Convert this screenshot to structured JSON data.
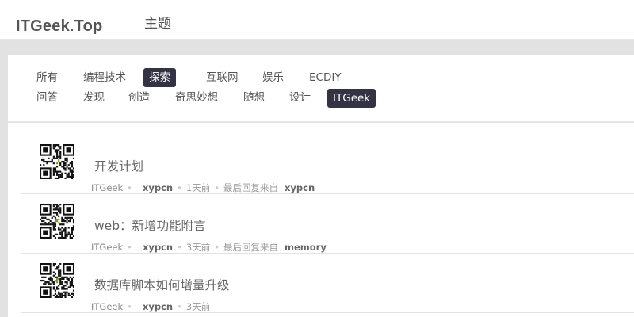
{
  "header": {
    "site_title": "ITGeek.Top",
    "nav_topics": "主题"
  },
  "tabs": {
    "row1": [
      "所有",
      "编程技术",
      "探索",
      "互联网",
      "娱乐",
      "ECDIY"
    ],
    "row2": [
      "问答",
      "发现",
      "创造",
      "奇思妙想",
      "随想",
      "设计",
      "ITGeek"
    ],
    "active": [
      "探索",
      "ITGeek"
    ]
  },
  "topics": [
    {
      "title": "开发计划",
      "node": "ITGeek",
      "author": "xypcn",
      "time": "1天前",
      "last_reply_label": "最后回复来自",
      "last_reply_user": "xypcn"
    },
    {
      "title": "web：新增功能附言",
      "node": "ITGeek",
      "author": "xypcn",
      "time": "3天前",
      "last_reply_label": "最后回复来自",
      "last_reply_user": "memory"
    },
    {
      "title": "数据库脚本如何增量升级",
      "node": "ITGeek",
      "author": "xypcn",
      "time": "3天前"
    }
  ],
  "separator": "•",
  "colors": {
    "active_tab_bg": "#333344",
    "page_bg": "#e2e2e2"
  },
  "icons": {
    "avatar": "qr-code-avatar-icon"
  }
}
